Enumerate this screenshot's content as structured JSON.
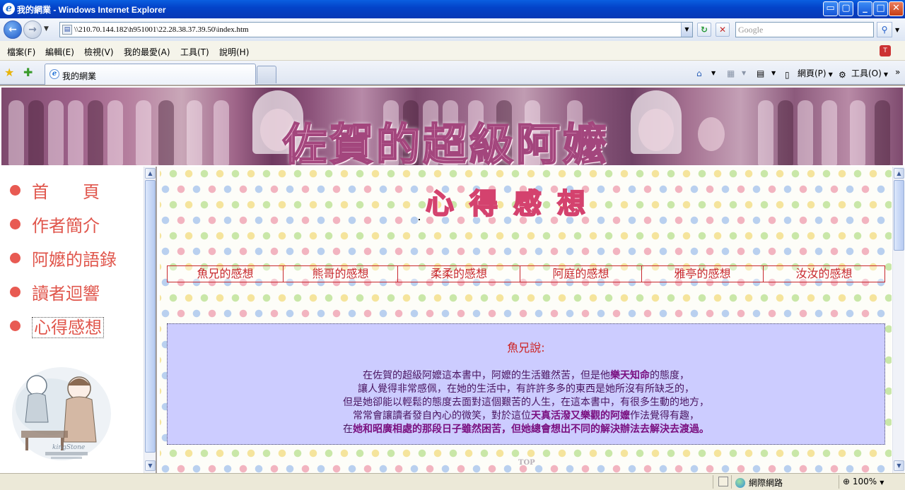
{
  "window": {
    "title": "我的網業 - Windows Internet Explorer",
    "minimize": "_",
    "maximize": "□",
    "close": "✕"
  },
  "address_bar": {
    "url": "\\\\210.70.144.182\\h951001\\22.28.38.37.39.50\\index.htm",
    "search_placeholder": "Google"
  },
  "menu": [
    "檔案(F)",
    "編輯(E)",
    "檢視(V)",
    "我的最愛(A)",
    "工具(T)",
    "說明(H)"
  ],
  "tab": {
    "label": "我的網業"
  },
  "command_bar": {
    "page_label": "網頁(P)",
    "tools_label": "工具(O)"
  },
  "banner": {
    "title": "佐賀的超級阿嬤"
  },
  "left_nav": {
    "items": [
      {
        "label": "首　　頁",
        "active": false
      },
      {
        "label": "作者簡介",
        "active": false
      },
      {
        "label": "阿嬤的語錄",
        "active": false
      },
      {
        "label": "讀者迴響",
        "active": false
      },
      {
        "label": "心得感想",
        "active": true
      }
    ],
    "dot_color": "#e85a52"
  },
  "main": {
    "title": "心得感想",
    "tabs": [
      "魚兄的感想",
      "熊哥的感想",
      "柔柔的感想",
      "阿庭的感想",
      "雅亭的感想",
      "汝汝的感想"
    ],
    "speaker": "魚兄說:",
    "lines": [
      {
        "pre": "在佐賀的超級阿嬤這本書中，阿嬤的生活雖然苦，但是他",
        "bold": "樂天知命",
        "post": "的態度，"
      },
      {
        "pre": "讓人覺得非常感佩，在她的生活中，有許許多多的東西是她所沒有所缺乏的，",
        "bold": "",
        "post": ""
      },
      {
        "pre": "但是她卻能以輕鬆的態度去面對這個艱苦的人生，在這本書中，有很多生動的地方，",
        "bold": "",
        "post": ""
      },
      {
        "pre": "常常會讓讀者發自內心的微笑，對於這位",
        "bold": "天真活潑又樂觀的阿嬤",
        "post": "作法覺得有趣，"
      },
      {
        "pre": "在",
        "bold": "她和昭廣相處的那段日子雖然困苦，但她總會想出不同的解決辦法去解決去渡過。",
        "post": ""
      }
    ],
    "top_link": "TOP",
    "accent_color": "#c8282e",
    "box_color": "#ccccff"
  },
  "status_bar": {
    "zone": "網際網路",
    "zoom": "100%"
  }
}
